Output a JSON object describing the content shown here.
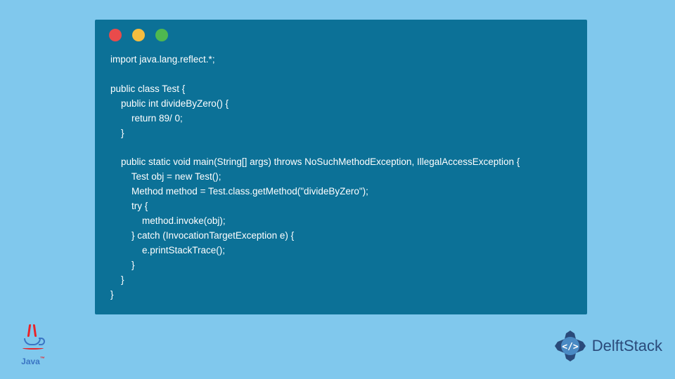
{
  "code": {
    "line1": "import java.lang.reflect.*;",
    "line2": "",
    "line3": "public class Test {",
    "line4": "    public int divideByZero() {",
    "line5": "        return 89/ 0;",
    "line6": "    }",
    "line7": "",
    "line8": "    public static void main(String[] args) throws NoSuchMethodException, IllegalAccessException {",
    "line9": "        Test obj = new Test();",
    "line10": "        Method method = Test.class.getMethod(\"divideByZero\");",
    "line11": "        try {",
    "line12": "            method.invoke(obj);",
    "line13": "        } catch (InvocationTargetException e) {",
    "line14": "            e.printStackTrace();",
    "line15": "        }",
    "line16": "    }",
    "line17": "}"
  },
  "logos": {
    "java": {
      "text": "Java",
      "tm": "™"
    },
    "delft": "DelftStack"
  }
}
